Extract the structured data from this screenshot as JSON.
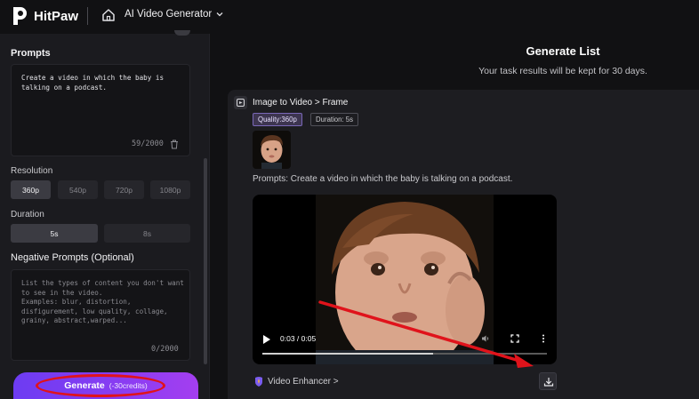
{
  "header": {
    "brand": "HitPaw",
    "app_select": "AI Video Generator"
  },
  "left": {
    "prompts_title": "Prompts",
    "prompt_text": "Create a video in which the baby is\ntalking on a podcast.",
    "prompt_counter": "59/2000",
    "resolution_label": "Resolution",
    "resolutions": [
      "360p",
      "540p",
      "720p",
      "1080p"
    ],
    "resolution_selected": "360p",
    "duration_label": "Duration",
    "durations": [
      "5s",
      "8s"
    ],
    "duration_selected": "5s",
    "negative_title": "Negative Prompts (Optional)",
    "negative_placeholder": "List the types of content you don't want\nto see in the video.\nExamples: blur, distortion,\ndisfigurement, low quality, collage,\ngrainy,  abstract,warped...",
    "negative_counter": "0/2000",
    "generate_label": "Generate",
    "generate_credits": "(-30credits)"
  },
  "right": {
    "title": "Generate List",
    "subtitle": "Your task results will be kept for 30 days.",
    "card": {
      "title": "Image to Video > Frame",
      "quality_tag": "Quality:360p",
      "duration_tag": "Duration: 5s",
      "prompt_label": "Prompts:",
      "prompt_text": "Create a video in which the baby is talking on a podcast.",
      "time": "0:03 / 0:05",
      "progress": 0.6,
      "enhancer_label": "Video Enhancer >"
    }
  },
  "colors": {
    "background": "#111113",
    "panel": "#1b1b1f",
    "accent_gradient": [
      "#6d3cf2",
      "#a43ef0"
    ],
    "annotation_red": "#e0131b"
  }
}
